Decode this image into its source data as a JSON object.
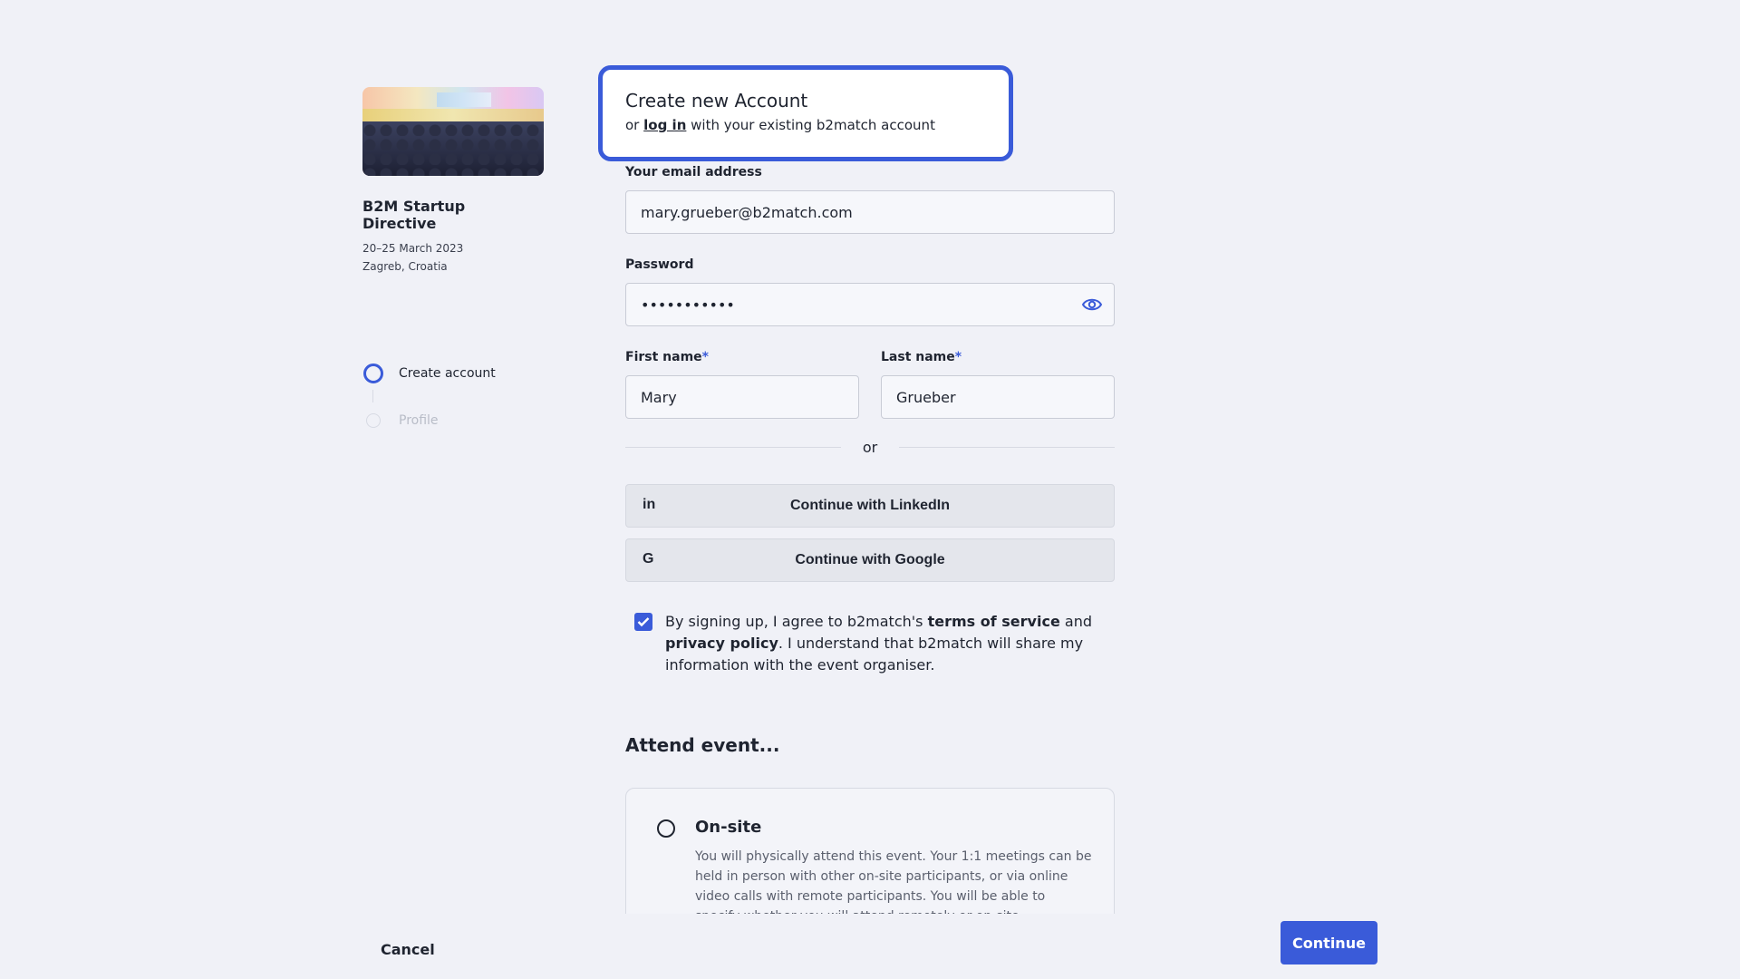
{
  "event": {
    "title": "B2M Startup Directive",
    "dates": "20–25 March 2023",
    "location": "Zagreb, Croatia"
  },
  "steps": [
    {
      "label": "Create account",
      "state": "active"
    },
    {
      "label": "Profile",
      "state": "inactive"
    }
  ],
  "header": {
    "title": "Create new Account",
    "or_text": "or",
    "login_link": "log in",
    "suffix": "with your existing b2match account"
  },
  "form": {
    "email_label": "Your email address",
    "email_value": "mary.grueber@b2match.com",
    "password_label": "Password",
    "password_value": "•••••••••••",
    "first_name_label": "First name",
    "first_name_value": "Mary",
    "last_name_label": "Last name",
    "last_name_value": "Grueber",
    "required_mark": "*"
  },
  "divider": {
    "text": "or"
  },
  "social": {
    "linkedin_label": "Continue with LinkedIn",
    "linkedin_icon": "in",
    "google_label": "Continue with Google",
    "google_icon": "G"
  },
  "terms": {
    "checked": true,
    "part1": "By signing up, I agree to b2match's",
    "tos": "terms of service",
    "and": "and",
    "privacy": "privacy policy",
    "part2": ". I understand that b2match will share my information with the event organiser."
  },
  "attend": {
    "title": "Attend event...",
    "option_title": "On-site",
    "option_desc": "You will physically attend this event. Your 1:1 meetings can be held in person with other on-site participants, or via online video calls with remote participants. You will be able to specify whether you will attend remotely or on-site."
  },
  "footer": {
    "cancel_label": "Cancel",
    "continue_label": "Continue"
  },
  "colors": {
    "accent": "#3a5bd9",
    "background": "#f0f1f7"
  }
}
